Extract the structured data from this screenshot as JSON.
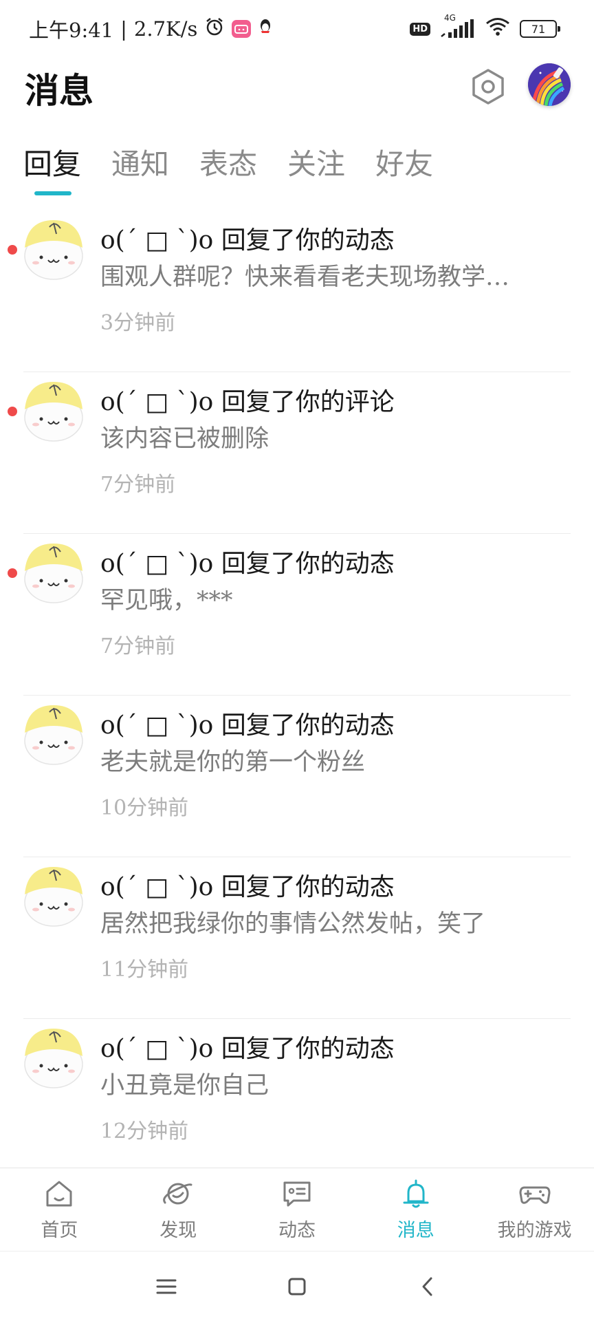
{
  "status_bar": {
    "time": "上午9:41",
    "separator": "|",
    "net_speed": "2.7K/s",
    "network_type": "4G",
    "hd_label": "HD",
    "battery": "71",
    "icons": [
      "alarm-icon",
      "bilibili-icon",
      "qq-icon",
      "signal-icon",
      "wifi-icon",
      "battery-icon"
    ]
  },
  "header": {
    "title": "消息",
    "settings_icon": "hexagon-settings-icon",
    "avatar_icon": "rainbow-avatar"
  },
  "tabs": [
    {
      "label": "回复",
      "active": true
    },
    {
      "label": "通知",
      "active": false
    },
    {
      "label": "表态",
      "active": false
    },
    {
      "label": "关注",
      "active": false
    },
    {
      "label": "好友",
      "active": false
    }
  ],
  "messages": [
    {
      "title": "o(´ □ `)o 回复了你的动态",
      "content": "围观人群呢？快来看看老夫现场教学…",
      "time": "3分钟前",
      "unread": true
    },
    {
      "title": "o(´ □ `)o 回复了你的评论",
      "content": "该内容已被删除",
      "time": "7分钟前",
      "unread": true
    },
    {
      "title": "o(´ □ `)o 回复了你的动态",
      "content": "罕见哦，***",
      "time": "7分钟前",
      "unread": true
    },
    {
      "title": "o(´ □ `)o 回复了你的动态",
      "content": "老夫就是你的第一个粉丝",
      "time": "10分钟前",
      "unread": false
    },
    {
      "title": "o(´ □ `)o 回复了你的动态",
      "content": "居然把我绿你的事情公然发帖，笑了",
      "time": "11分钟前",
      "unread": false
    },
    {
      "title": "o(´ □ `)o 回复了你的动态",
      "content": "小丑竟是你自己",
      "time": "12分钟前",
      "unread": false
    }
  ],
  "bottom_nav": [
    {
      "label": "首页",
      "icon": "home-icon",
      "active": false
    },
    {
      "label": "发现",
      "icon": "planet-icon",
      "active": false
    },
    {
      "label": "动态",
      "icon": "chat-card-icon",
      "active": false
    },
    {
      "label": "消息",
      "icon": "bell-icon",
      "active": true
    },
    {
      "label": "我的游戏",
      "icon": "gamepad-icon",
      "active": false
    }
  ],
  "colors": {
    "accent": "#21b6c9",
    "unread_dot": "#ef4a4a",
    "text_primary": "#1a1a1a",
    "text_secondary": "#7d7d7d",
    "text_muted": "#b3b3b3"
  }
}
